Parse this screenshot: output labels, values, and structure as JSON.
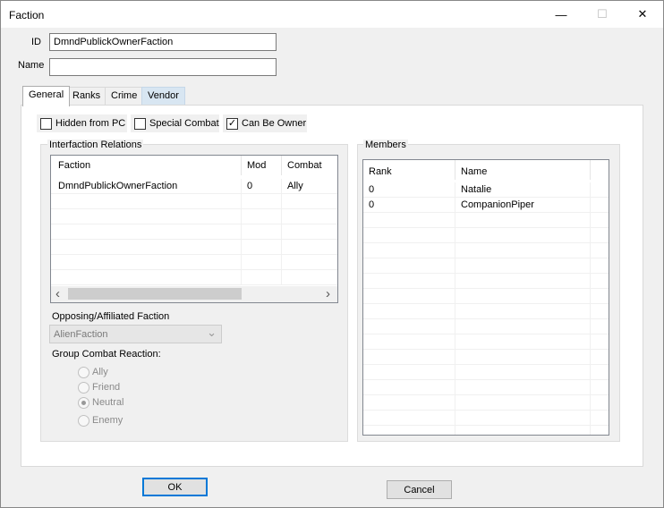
{
  "window": {
    "title": "Faction",
    "minimize_glyph": "—",
    "maximize_glyph": "☐",
    "close_glyph": "✕"
  },
  "fields": {
    "id_label": "ID",
    "id_value": "DmndPublickOwnerFaction",
    "name_label": "Name",
    "name_value": ""
  },
  "tabs": [
    {
      "label": "General",
      "active": true
    },
    {
      "label": "Ranks"
    },
    {
      "label": "Crime"
    },
    {
      "label": "Vendor",
      "hover": true
    }
  ],
  "checkboxes": [
    {
      "label": "Hidden from PC",
      "checked": false
    },
    {
      "label": "Special Combat",
      "checked": false
    },
    {
      "label": "Can Be Owner",
      "checked": true
    }
  ],
  "interfaction": {
    "title": "Interfaction Relations",
    "columns": [
      "Faction",
      "Mod",
      "Combat"
    ],
    "rows": [
      {
        "faction": "DmndPublickOwnerFaction",
        "mod": "0",
        "combat": "Ally"
      }
    ]
  },
  "opposing": {
    "label": "Opposing/Affiliated Faction",
    "selected": "AlienFaction"
  },
  "group_combat": {
    "label": "Group Combat Reaction:",
    "options": [
      "Ally",
      "Friend",
      "Neutral",
      "Enemy"
    ],
    "selected": "Neutral"
  },
  "members": {
    "title": "Members",
    "columns": [
      "Rank",
      "Name"
    ],
    "rows": [
      {
        "rank": "0",
        "name": "Natalie"
      },
      {
        "rank": "0",
        "name": "CompanionPiper"
      }
    ]
  },
  "buttons": {
    "ok": "OK",
    "cancel": "Cancel"
  },
  "icons": {
    "scroll_left": "‹",
    "scroll_right": "›",
    "combo_arrow": "⌄",
    "check": "✓"
  },
  "colors": {
    "accent": "#0078d7",
    "tab_hover": "#d8e6f2"
  }
}
